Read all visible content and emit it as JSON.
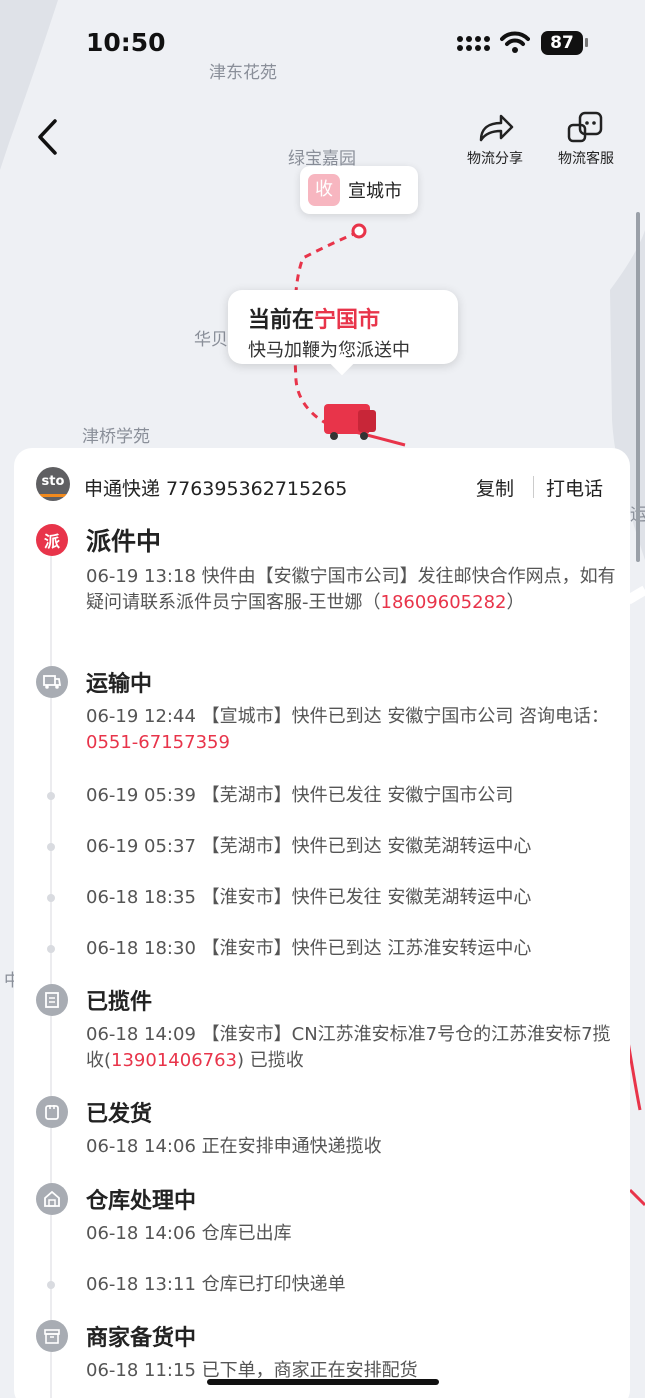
{
  "status_bar": {
    "time": "10:50",
    "battery": "87"
  },
  "map": {
    "places": [
      "津东花苑",
      "绿宝嘉园",
      "华贝",
      "津桥学苑",
      "运",
      "中"
    ],
    "receiver_tag": "收",
    "receiver_city": "宣城市",
    "current_prefix": "当前在",
    "current_city": "宁国市",
    "current_sub": "快马加鞭为您派送中"
  },
  "header": {
    "share_label": "物流分享",
    "service_label": "物流客服"
  },
  "package": {
    "courier_logo": "sto",
    "courier_name": "申通快递 776395362715265",
    "copy_label": "复制",
    "call_label": "打电话"
  },
  "events": [
    {
      "title": "派件中",
      "node_label": "派",
      "text": "06-19 13:18  快件由【安徽宁国市公司】发往邮快合作网点，如有疑问请联系派件员宁国客服-王世娜（",
      "phone": "18609605282",
      "suffix": "）"
    },
    {
      "title": "运输中",
      "text": "06-19 12:44 【宣城市】快件已到达 安徽宁国市公司 咨询电话：",
      "phone": "0551-67157359",
      "suffix": ""
    },
    {
      "text": "06-19 05:39 【芜湖市】快件已发往 安徽宁国市公司"
    },
    {
      "text": "06-19 05:37 【芜湖市】快件已到达 安徽芜湖转运中心"
    },
    {
      "text": "06-18 18:35 【淮安市】快件已发往 安徽芜湖转运中心"
    },
    {
      "text": "06-18 18:30 【淮安市】快件已到达 江苏淮安转运中心"
    },
    {
      "title": "已揽件",
      "text": "06-18 14:09 【淮安市】CN江苏淮安标准7号仓的江苏淮安标7揽收(",
      "phone": "13901406763",
      "suffix": ") 已揽收"
    },
    {
      "title": "已发货",
      "text": "06-18 14:06  正在安排申通快递揽收"
    },
    {
      "title": "仓库处理中",
      "text": "06-18 14:06  仓库已出库"
    },
    {
      "text": "06-18 13:11  仓库已打印快递单"
    },
    {
      "title": "商家备货中",
      "text": "06-18 11:15  已下单，商家正在安排配货"
    }
  ],
  "colors": {
    "accent": "#e8344a",
    "node_grey": "#a8acb3",
    "map_bg": "#eef0f4"
  }
}
